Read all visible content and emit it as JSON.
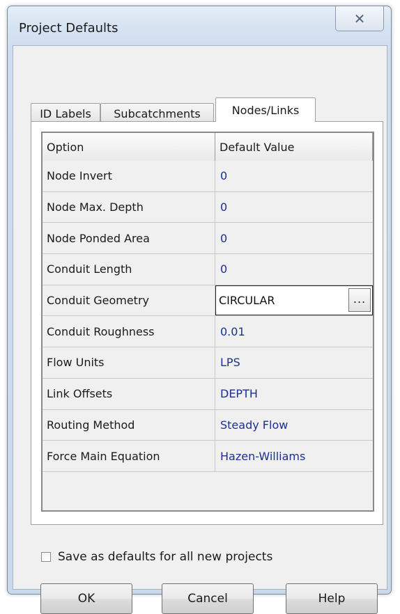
{
  "window": {
    "title": "Project Defaults",
    "close_glyph": "✕"
  },
  "tabs": [
    {
      "label": "ID Labels"
    },
    {
      "label": "Subcatchments"
    },
    {
      "label": "Nodes/Links"
    }
  ],
  "grid": {
    "headers": {
      "option": "Option",
      "value": "Default Value"
    },
    "rows": [
      {
        "option": "Node Invert",
        "value": "0"
      },
      {
        "option": "Node Max. Depth",
        "value": "0"
      },
      {
        "option": "Node Ponded Area",
        "value": "0"
      },
      {
        "option": "Conduit Length",
        "value": "0"
      },
      {
        "option": "Conduit Geometry",
        "value": "CIRCULAR"
      },
      {
        "option": "Conduit Roughness",
        "value": "0.01"
      },
      {
        "option": "Flow Units",
        "value": "LPS"
      },
      {
        "option": "Link Offsets",
        "value": "DEPTH"
      },
      {
        "option": "Routing Method",
        "value": "Steady Flow"
      },
      {
        "option": "Force Main Equation",
        "value": "Hazen-Williams"
      }
    ],
    "ellipsis_label": "..."
  },
  "save_defaults": {
    "label": "Save as defaults for all new projects",
    "checked": false
  },
  "buttons": {
    "ok": "OK",
    "cancel": "Cancel",
    "help": "Help"
  },
  "colors": {
    "value_text": "#1b2f8f"
  }
}
